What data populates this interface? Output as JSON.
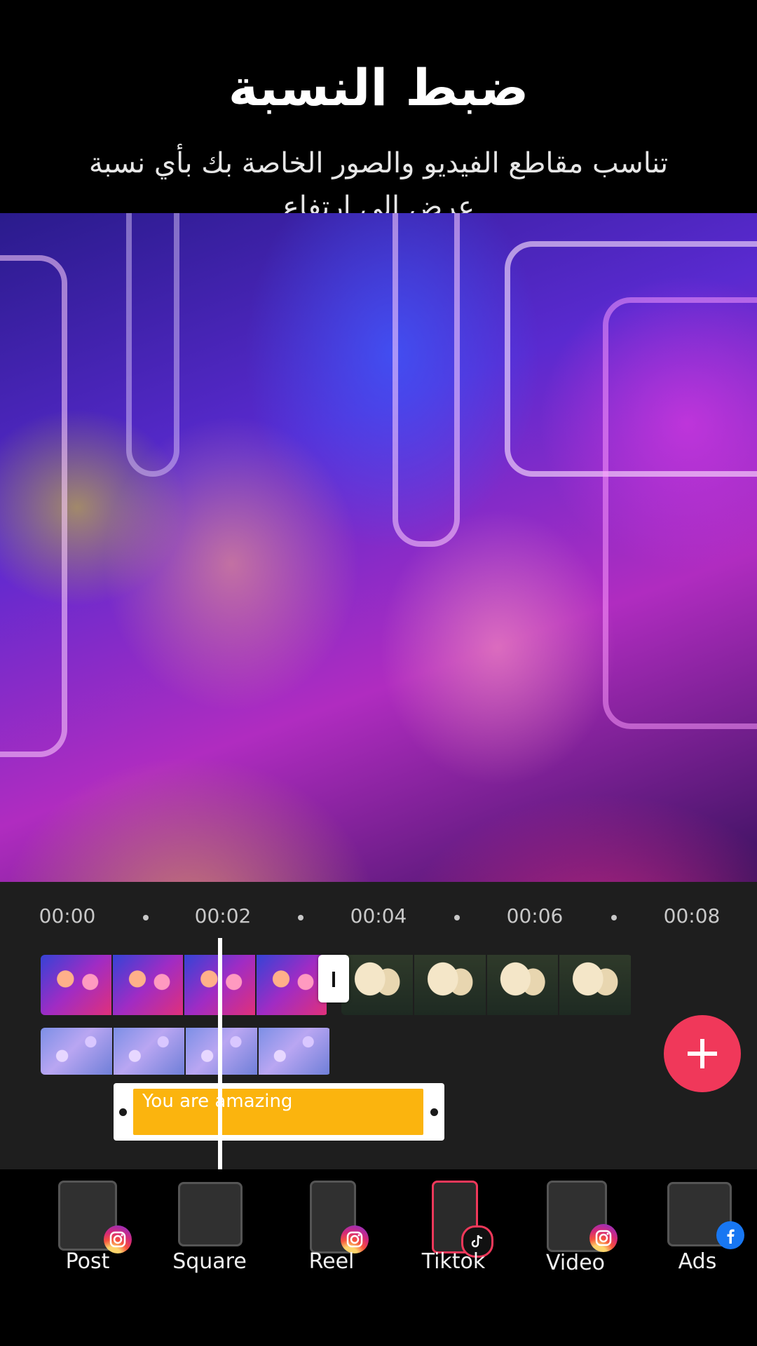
{
  "header": {
    "title": "ضبط النسبة",
    "subtitle": "تناسب مقاطع الفيديو والصور الخاصة بك بأي نسبة عرض إلى ارتفاع"
  },
  "timeline": {
    "ruler": [
      "00:00",
      "00:02",
      "00:04",
      "00:06",
      "00:08"
    ],
    "text_clip": "You are amazing"
  },
  "formats": [
    {
      "label": "Post",
      "badge": "instagram-icon"
    },
    {
      "label": "Square",
      "badge": ""
    },
    {
      "label": "Reel",
      "badge": "instagram-icon"
    },
    {
      "label": "Tiktok",
      "badge": "tiktok-icon",
      "selected": true
    },
    {
      "label": "Video",
      "badge": "instagram-icon"
    },
    {
      "label": "Ads",
      "badge": "facebook-icon"
    }
  ],
  "colors": {
    "accent": "#f0385a",
    "text_clip": "#fbb40e",
    "timeline_bg": "#1e1e1e"
  }
}
